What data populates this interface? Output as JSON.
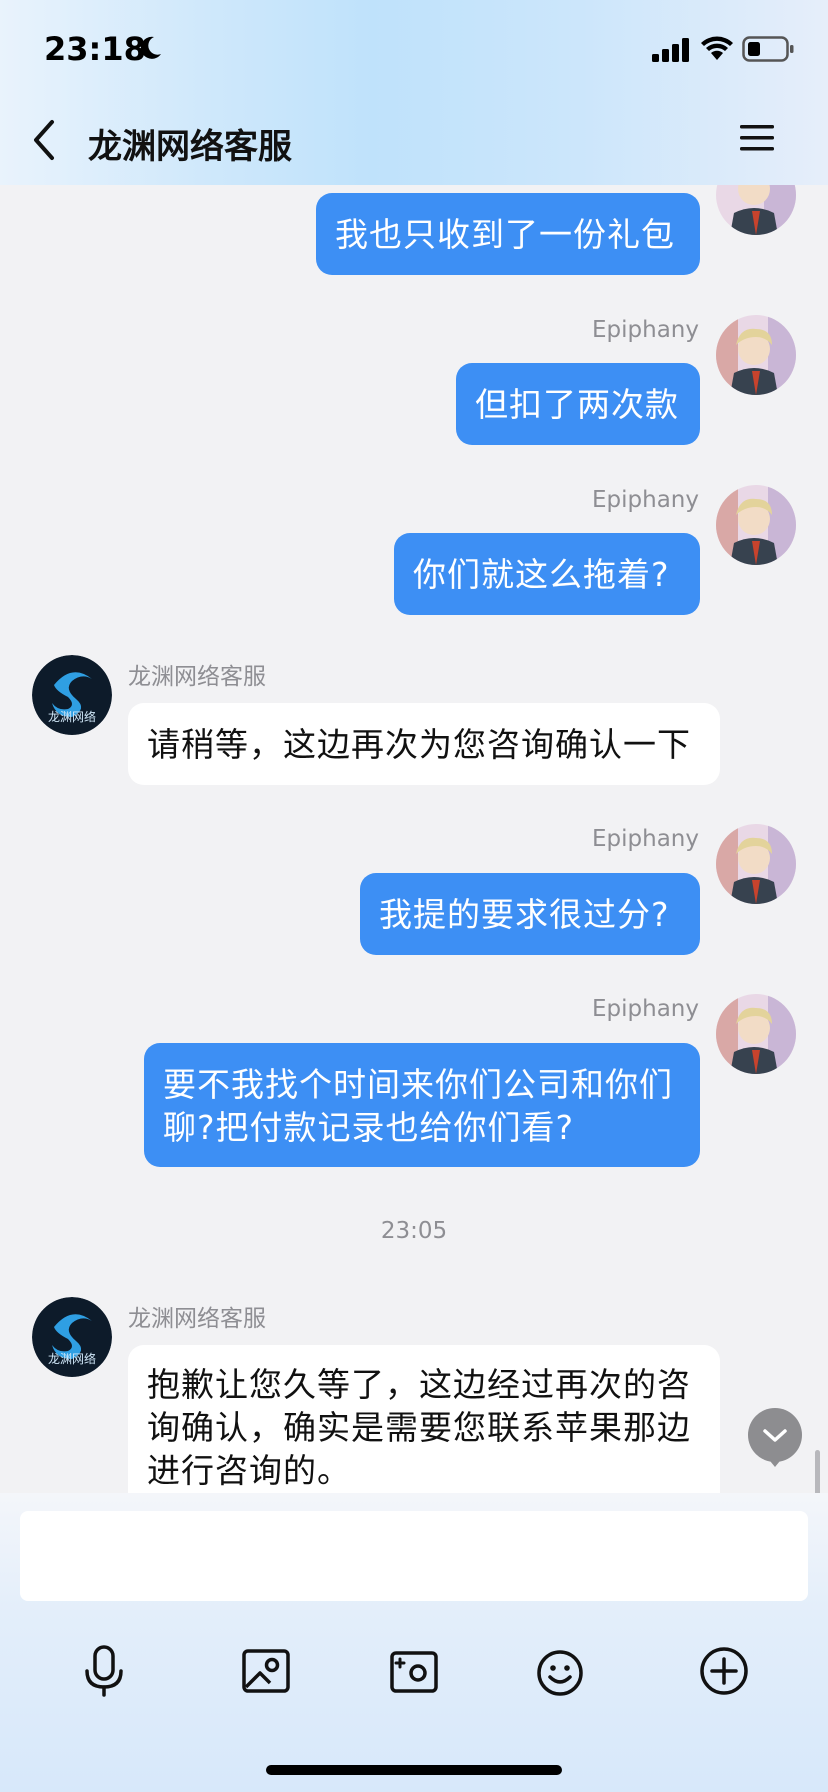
{
  "status_bar": {
    "time": "23:18"
  },
  "header": {
    "title": "龙渊网络客服"
  },
  "colors": {
    "outgoing_bubble": "#3d8ff4",
    "incoming_bubble": "#ffffff",
    "background": "#f2f2f4"
  },
  "messages": [
    {
      "direction": "out",
      "sender": "",
      "text": "我也只收到了一份礼包"
    },
    {
      "direction": "out",
      "sender": "Epiphany",
      "text": "但扣了两次款"
    },
    {
      "direction": "out",
      "sender": "Epiphany",
      "text": "你们就这么拖着?"
    },
    {
      "direction": "in",
      "sender": "龙渊网络客服",
      "text": "请稍等，这边再次为您咨询确认一下"
    },
    {
      "direction": "out",
      "sender": "Epiphany",
      "text": "我提的要求很过分?"
    },
    {
      "direction": "out",
      "sender": "Epiphany",
      "lines": [
        "要不我找个时间来你们公司和你们",
        "聊?把付款记录也给你们看?"
      ]
    },
    {
      "direction": "in",
      "sender": "龙渊网络客服",
      "lines": [
        "抱歉让您久等了，这边经过再次的咨",
        "询确认，确实是需要您联系苹果那边",
        "进行咨询的。"
      ]
    }
  ],
  "timestamp": "23:05",
  "cs_avatar_text": "龙渊网络",
  "composer": {
    "placeholder": "",
    "tools": [
      "microphone-icon",
      "image-icon",
      "camera-icon",
      "emoji-icon",
      "plus-icon"
    ]
  }
}
